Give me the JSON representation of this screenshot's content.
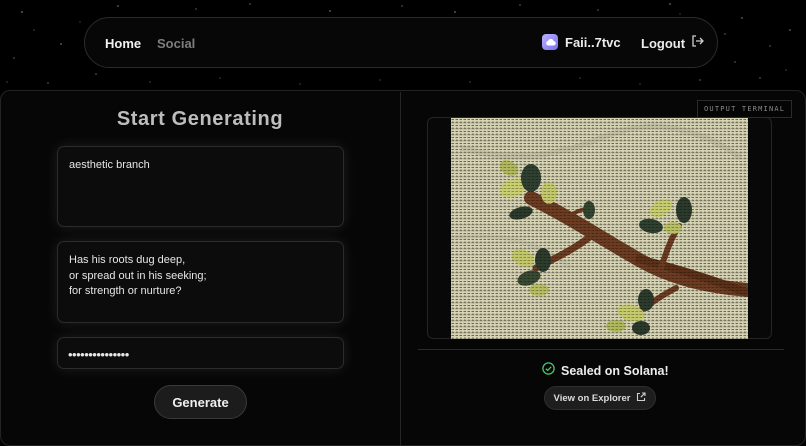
{
  "nav": {
    "home_label": "Home",
    "social_label": "Social",
    "wallet_label": "Faii..7tvc",
    "wallet_icon": "cloud-wallet-icon",
    "logout_label": "Logout",
    "logout_icon": "logout-arrow-icon"
  },
  "generator": {
    "title": "Start Generating",
    "prompt_value": "aesthetic branch",
    "poem_value": "Has his roots dug deep,\nor spread out in his seeking;\nfor strength or nurture?",
    "password_value": "•••••••••••••••",
    "generate_label": "Generate"
  },
  "output": {
    "terminal_label": "OUTPUT TERMINAL",
    "art_subject": "ASCII art of a tree branch with leaves",
    "status_text": "Sealed on Solana!",
    "status_icon": "check-circle-icon",
    "explorer_label": "View on Explorer",
    "explorer_icon": "external-link-icon"
  },
  "colors": {
    "background": "#000000",
    "panel": "#060606",
    "accent_wallet": "#9d93ff",
    "success": "#4cc46a",
    "art_background": "#d9d5b9",
    "branch": "#6a3a22",
    "leaf": "#b8c05a"
  }
}
